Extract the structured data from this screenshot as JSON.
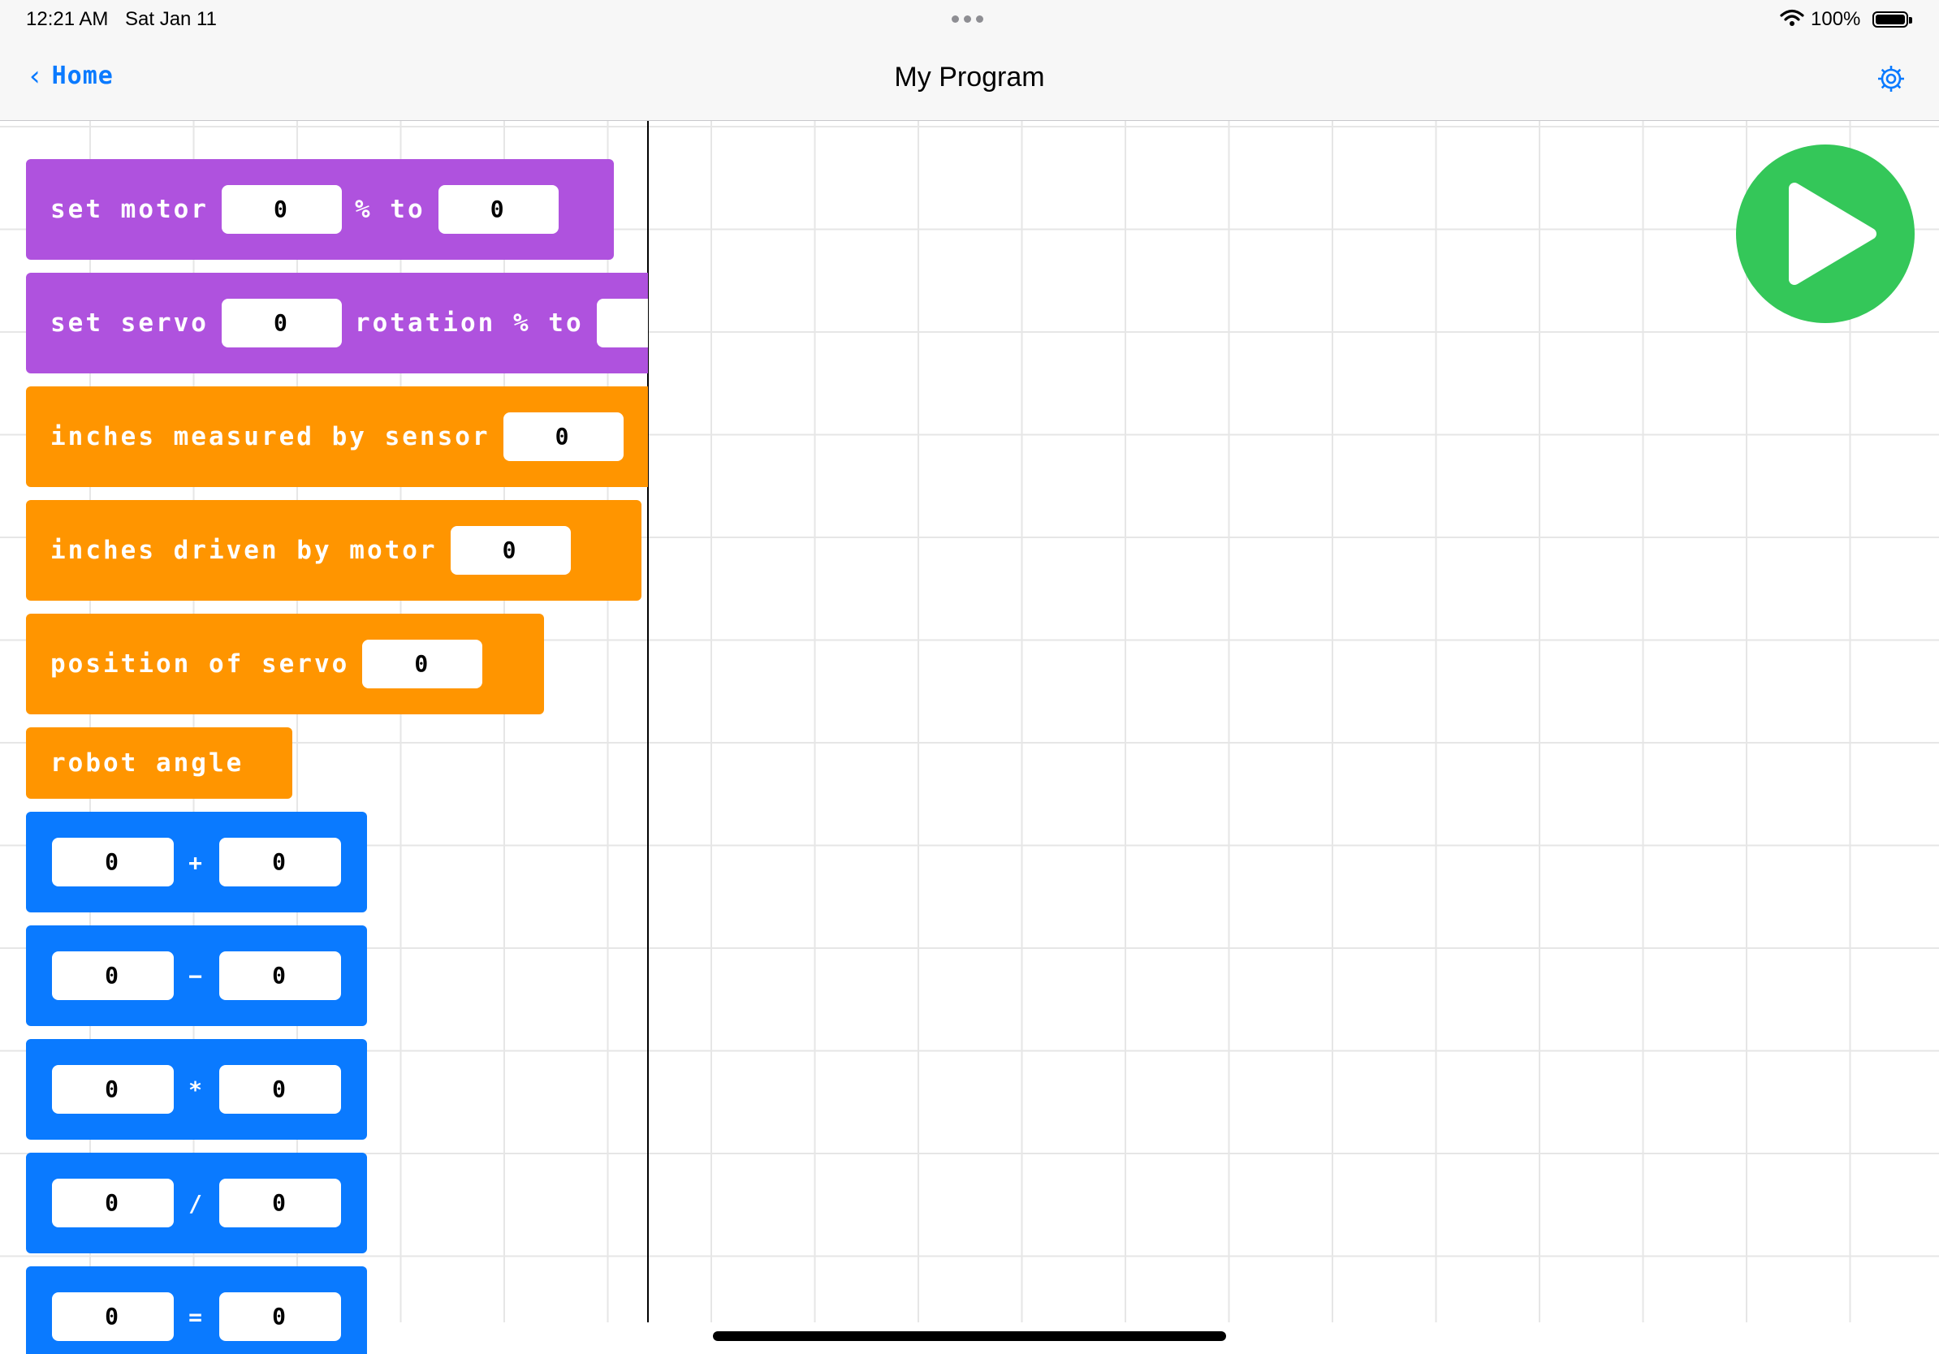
{
  "status_bar": {
    "time": "12:21 AM",
    "date": "Sat Jan 11",
    "battery": "100%",
    "icons": [
      "wifi-icon",
      "battery-icon",
      "multitasking-dots-icon"
    ]
  },
  "navbar": {
    "back_label": "Home",
    "title": "My Program",
    "icons": [
      "chevron-left-icon",
      "gear-icon"
    ]
  },
  "palette": {
    "set_motor": {
      "label1": "set motor",
      "slot1": "0",
      "label2": "% to",
      "slot2": "0"
    },
    "set_servo": {
      "label1": "set servo",
      "slot1": "0",
      "label2": "rotation % to"
    },
    "inches_sensor": {
      "label": "inches measured by sensor",
      "slot": "0"
    },
    "inches_motor": {
      "label": "inches driven by motor",
      "slot": "0"
    },
    "position_servo": {
      "label": "position of servo",
      "slot": "0"
    },
    "robot_angle": {
      "label": "robot angle"
    },
    "math": [
      {
        "left": "0",
        "op": "+",
        "right": "0"
      },
      {
        "left": "0",
        "op": "−",
        "right": "0"
      },
      {
        "left": "0",
        "op": "*",
        "right": "0"
      },
      {
        "left": "0",
        "op": "/",
        "right": "0"
      },
      {
        "left": "0",
        "op": "=",
        "right": "0"
      }
    ]
  },
  "run_button": {
    "icon": "play-icon"
  },
  "colors": {
    "accent": "#0a7aff",
    "motion_block": "#af52de",
    "sensor_block": "#ff9500",
    "math_block": "#0a7aff",
    "run": "#34c759"
  }
}
